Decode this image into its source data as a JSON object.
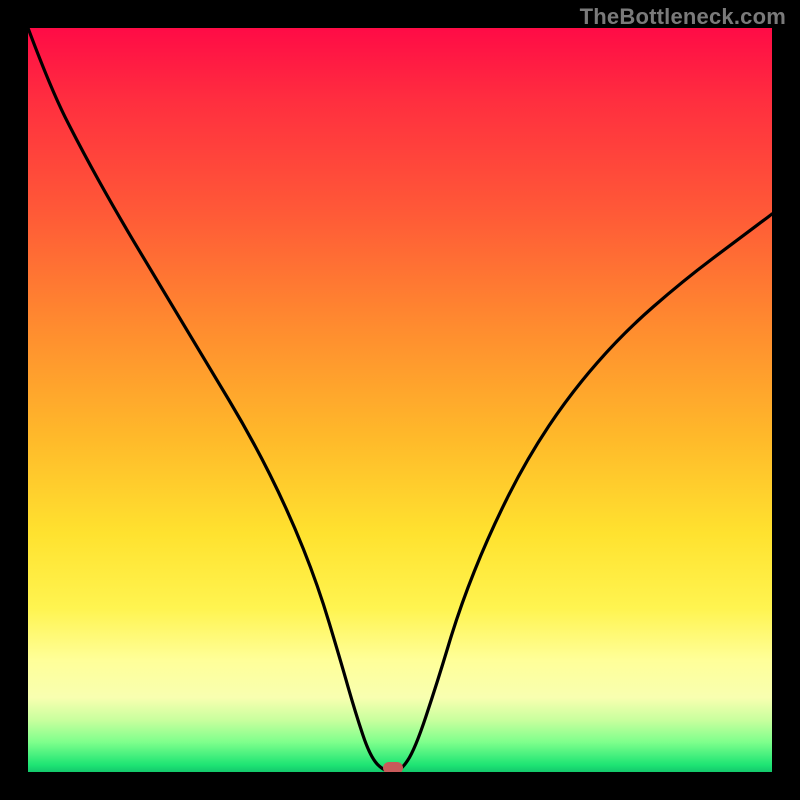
{
  "watermark": "TheBottleneck.com",
  "colors": {
    "page_bg": "#000000",
    "curve": "#000000",
    "marker": "#c85a5a",
    "watermark_text": "#7a7a7a"
  },
  "chart_data": {
    "type": "line",
    "title": "",
    "xlabel": "",
    "ylabel": "",
    "xlim": [
      0,
      100
    ],
    "ylim": [
      0,
      100
    ],
    "grid": false,
    "legend": false,
    "note": "y=0 (green) at bottom, y=100 (red) at top; values estimated from pixels",
    "series": [
      {
        "name": "bottleneck-curve",
        "x": [
          0,
          3,
          7,
          12,
          18,
          24,
          30,
          35,
          39,
          42,
          44,
          46,
          48,
          50,
          52,
          55,
          58,
          62,
          67,
          73,
          80,
          88,
          96,
          100
        ],
        "y": [
          100,
          92,
          84,
          75,
          65,
          55,
          45,
          35,
          25,
          15,
          8,
          2,
          0,
          0,
          3,
          12,
          22,
          32,
          42,
          51,
          59,
          66,
          72,
          75
        ]
      }
    ],
    "marker": {
      "x": 49,
      "y": 0
    },
    "background_gradient": {
      "orientation": "vertical",
      "stops": [
        {
          "pos": 0.0,
          "color": "#ff0b46"
        },
        {
          "pos": 0.25,
          "color": "#ff5a37"
        },
        {
          "pos": 0.55,
          "color": "#ffb92a"
        },
        {
          "pos": 0.78,
          "color": "#fff450"
        },
        {
          "pos": 0.9,
          "color": "#f8ffb0"
        },
        {
          "pos": 0.96,
          "color": "#7eff8c"
        },
        {
          "pos": 1.0,
          "color": "#13c96c"
        }
      ]
    }
  }
}
